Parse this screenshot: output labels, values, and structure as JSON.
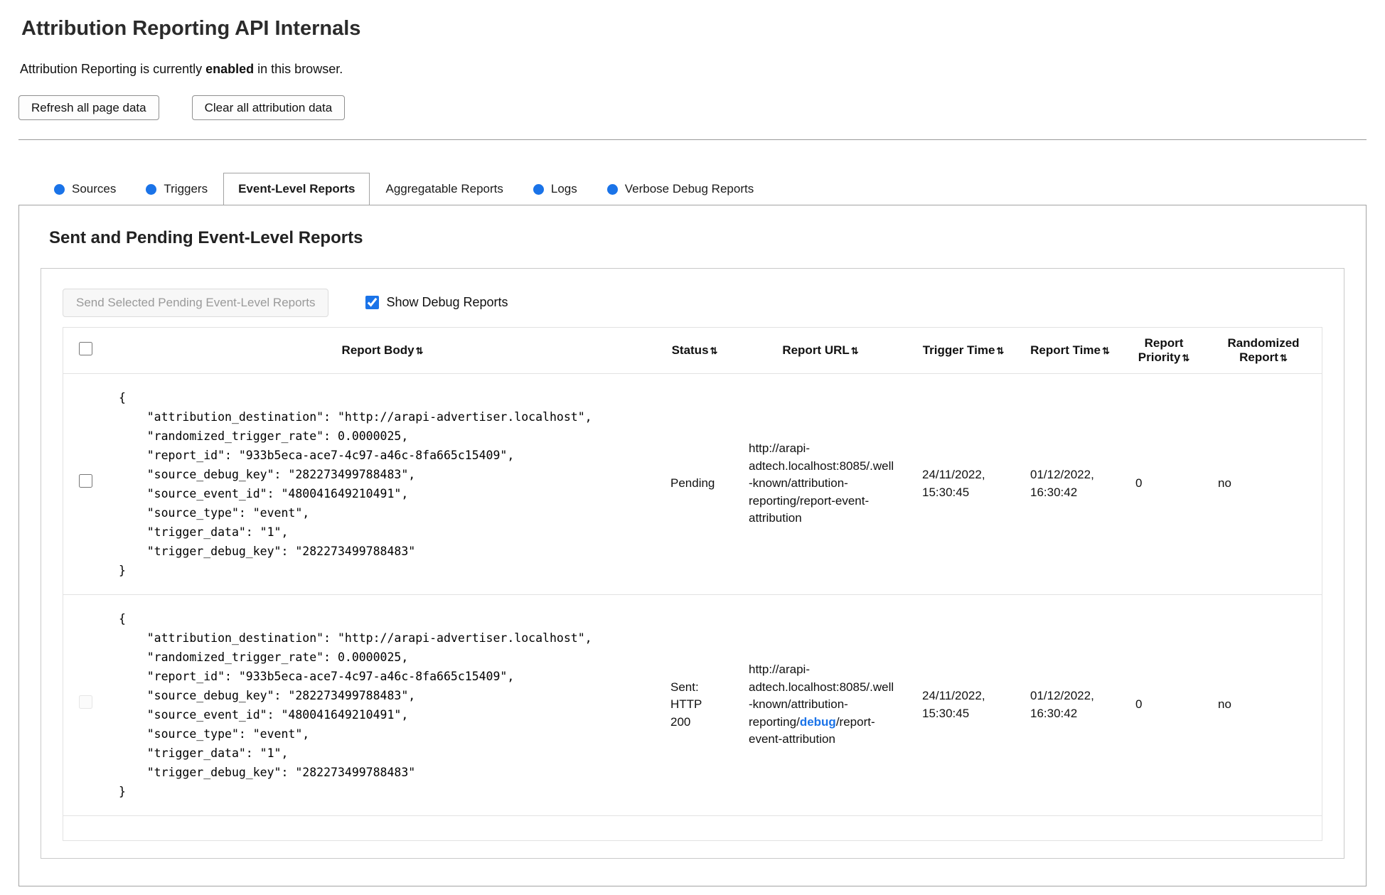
{
  "page": {
    "title": "Attribution Reporting API Internals",
    "status": {
      "prefix": "Attribution Reporting is currently ",
      "emphasis": "enabled",
      "suffix": " in this browser."
    },
    "buttons": {
      "refresh": "Refresh all page data",
      "clear": "Clear all attribution data"
    }
  },
  "colors": {
    "accent_blue": "#1a73e8"
  },
  "tabs": {
    "items": [
      {
        "label": "Sources",
        "has_dot": true,
        "active": false
      },
      {
        "label": "Triggers",
        "has_dot": true,
        "active": false
      },
      {
        "label": "Event-Level Reports",
        "has_dot": false,
        "active": true
      },
      {
        "label": "Aggregatable Reports",
        "has_dot": false,
        "active": false
      },
      {
        "label": "Logs",
        "has_dot": true,
        "active": false
      },
      {
        "label": "Verbose Debug Reports",
        "has_dot": true,
        "active": false
      }
    ]
  },
  "report_section": {
    "heading": "Sent and Pending Event-Level Reports",
    "send_button_label": "Send Selected Pending Event-Level Reports",
    "send_button_enabled": false,
    "show_debug_label": "Show Debug Reports",
    "show_debug_checked": true
  },
  "table": {
    "sort_icon": "⇅",
    "select_all_checked": false,
    "headers": {
      "report_body": "Report Body",
      "status": "Status",
      "report_url": "Report URL",
      "trigger_time": "Trigger Time",
      "report_time": "Report Time",
      "report_priority": "Report Priority",
      "randomized_report": "Randomized Report"
    },
    "rows": [
      {
        "selected": false,
        "checkbox_enabled": true,
        "report_body": "{\n    \"attribution_destination\": \"http://arapi-advertiser.localhost\",\n    \"randomized_trigger_rate\": 0.0000025,\n    \"report_id\": \"933b5eca-ace7-4c97-a46c-8fa665c15409\",\n    \"source_debug_key\": \"282273499788483\",\n    \"source_event_id\": \"480041649210491\",\n    \"source_type\": \"event\",\n    \"trigger_data\": \"1\",\n    \"trigger_debug_key\": \"282273499788483\"\n}",
        "status": "Pending",
        "report_url": "http://arapi-adtech.localhost:8085/.well-known/attribution-reporting/report-event-attribution",
        "trigger_time": "24/11/2022, 15:30:45",
        "report_time": "01/12/2022, 16:30:42",
        "report_priority": "0",
        "randomized_report": "no"
      },
      {
        "selected": false,
        "checkbox_enabled": false,
        "report_body": "{\n    \"attribution_destination\": \"http://arapi-advertiser.localhost\",\n    \"randomized_trigger_rate\": 0.0000025,\n    \"report_id\": \"933b5eca-ace7-4c97-a46c-8fa665c15409\",\n    \"source_debug_key\": \"282273499788483\",\n    \"source_event_id\": \"480041649210491\",\n    \"source_type\": \"event\",\n    \"trigger_data\": \"1\",\n    \"trigger_debug_key\": \"282273499788483\"\n}",
        "status": "Sent: HTTP 200",
        "report_url_prefix": "http://arapi-adtech.localhost:8085/.well-known/attribution-reporting/",
        "report_url_highlight": "debug",
        "report_url_suffix": "/report-event-attribution",
        "trigger_time": "24/11/2022, 15:30:45",
        "report_time": "01/12/2022, 16:30:42",
        "report_priority": "0",
        "randomized_report": "no"
      }
    ]
  }
}
